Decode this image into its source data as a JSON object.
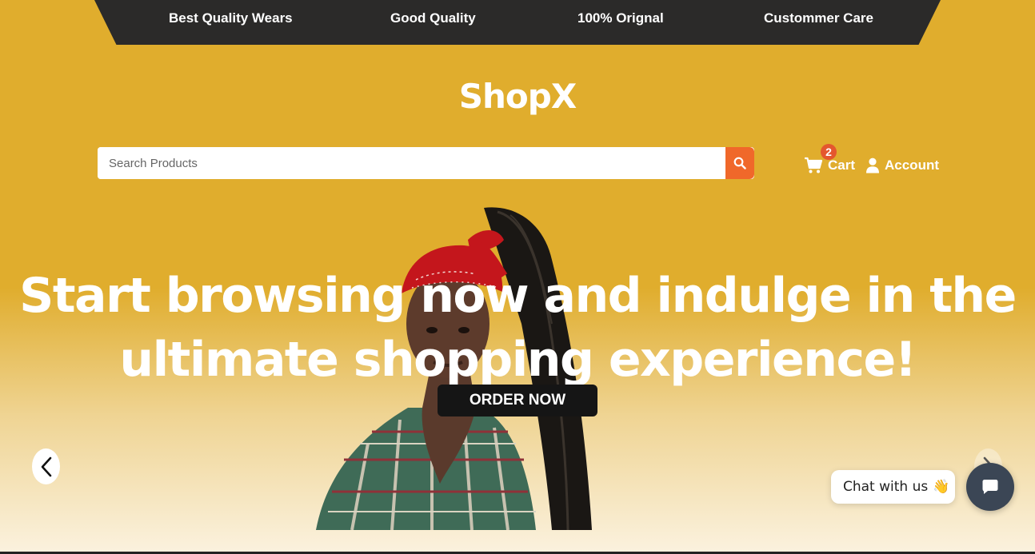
{
  "topbar": {
    "items": [
      "Best Quality Wears",
      "Good Quality",
      "100% Orignal",
      "Custommer Care"
    ]
  },
  "header": {
    "logo": "ShopX",
    "search": {
      "placeholder": "Search Products",
      "value": ""
    },
    "cart": {
      "label": "Cart",
      "count": "2"
    },
    "account": {
      "label": "Account"
    }
  },
  "hero": {
    "title_line1": "Start browsing now and indulge in the",
    "title_line2": "ultimate shopping experience!",
    "cta": "ORDER NOW"
  },
  "chat": {
    "label": "Chat with us",
    "emoji": "👋"
  },
  "colors": {
    "background": "#e0ad2d",
    "topbar": "#2b2a29",
    "accent": "#f0682a",
    "cta": "#151515",
    "chat_button": "#3b4655"
  },
  "icons": [
    "search-icon",
    "cart-icon",
    "user-icon",
    "chevron-left-icon",
    "chevron-right-icon",
    "chat-icon"
  ]
}
